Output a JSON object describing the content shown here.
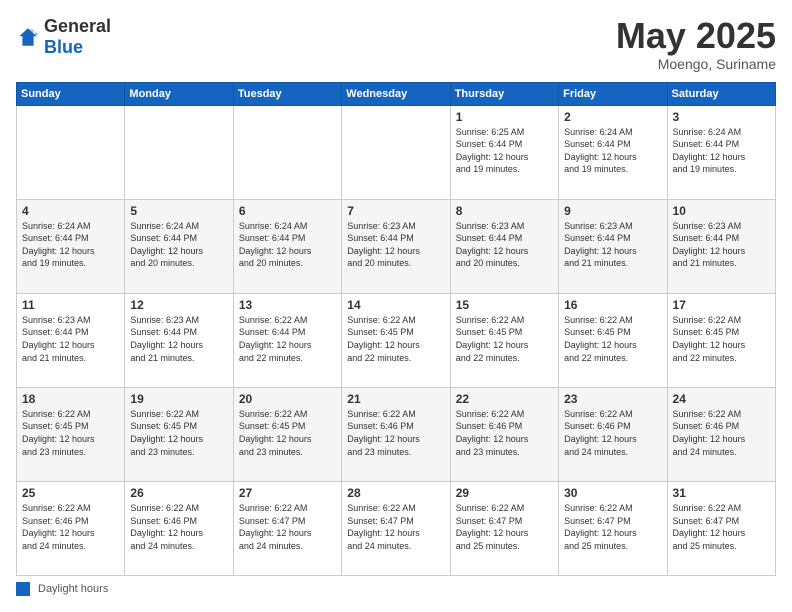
{
  "header": {
    "logo_general": "General",
    "logo_blue": "Blue",
    "month_title": "May 2025",
    "location": "Moengo, Suriname"
  },
  "footer": {
    "daylight_label": "Daylight hours"
  },
  "days_of_week": [
    "Sunday",
    "Monday",
    "Tuesday",
    "Wednesday",
    "Thursday",
    "Friday",
    "Saturday"
  ],
  "weeks": [
    [
      {
        "day": "",
        "info": ""
      },
      {
        "day": "",
        "info": ""
      },
      {
        "day": "",
        "info": ""
      },
      {
        "day": "",
        "info": ""
      },
      {
        "day": "1",
        "info": "Sunrise: 6:25 AM\nSunset: 6:44 PM\nDaylight: 12 hours\nand 19 minutes."
      },
      {
        "day": "2",
        "info": "Sunrise: 6:24 AM\nSunset: 6:44 PM\nDaylight: 12 hours\nand 19 minutes."
      },
      {
        "day": "3",
        "info": "Sunrise: 6:24 AM\nSunset: 6:44 PM\nDaylight: 12 hours\nand 19 minutes."
      }
    ],
    [
      {
        "day": "4",
        "info": "Sunrise: 6:24 AM\nSunset: 6:44 PM\nDaylight: 12 hours\nand 19 minutes."
      },
      {
        "day": "5",
        "info": "Sunrise: 6:24 AM\nSunset: 6:44 PM\nDaylight: 12 hours\nand 20 minutes."
      },
      {
        "day": "6",
        "info": "Sunrise: 6:24 AM\nSunset: 6:44 PM\nDaylight: 12 hours\nand 20 minutes."
      },
      {
        "day": "7",
        "info": "Sunrise: 6:23 AM\nSunset: 6:44 PM\nDaylight: 12 hours\nand 20 minutes."
      },
      {
        "day": "8",
        "info": "Sunrise: 6:23 AM\nSunset: 6:44 PM\nDaylight: 12 hours\nand 20 minutes."
      },
      {
        "day": "9",
        "info": "Sunrise: 6:23 AM\nSunset: 6:44 PM\nDaylight: 12 hours\nand 21 minutes."
      },
      {
        "day": "10",
        "info": "Sunrise: 6:23 AM\nSunset: 6:44 PM\nDaylight: 12 hours\nand 21 minutes."
      }
    ],
    [
      {
        "day": "11",
        "info": "Sunrise: 6:23 AM\nSunset: 6:44 PM\nDaylight: 12 hours\nand 21 minutes."
      },
      {
        "day": "12",
        "info": "Sunrise: 6:23 AM\nSunset: 6:44 PM\nDaylight: 12 hours\nand 21 minutes."
      },
      {
        "day": "13",
        "info": "Sunrise: 6:22 AM\nSunset: 6:44 PM\nDaylight: 12 hours\nand 22 minutes."
      },
      {
        "day": "14",
        "info": "Sunrise: 6:22 AM\nSunset: 6:45 PM\nDaylight: 12 hours\nand 22 minutes."
      },
      {
        "day": "15",
        "info": "Sunrise: 6:22 AM\nSunset: 6:45 PM\nDaylight: 12 hours\nand 22 minutes."
      },
      {
        "day": "16",
        "info": "Sunrise: 6:22 AM\nSunset: 6:45 PM\nDaylight: 12 hours\nand 22 minutes."
      },
      {
        "day": "17",
        "info": "Sunrise: 6:22 AM\nSunset: 6:45 PM\nDaylight: 12 hours\nand 22 minutes."
      }
    ],
    [
      {
        "day": "18",
        "info": "Sunrise: 6:22 AM\nSunset: 6:45 PM\nDaylight: 12 hours\nand 23 minutes."
      },
      {
        "day": "19",
        "info": "Sunrise: 6:22 AM\nSunset: 6:45 PM\nDaylight: 12 hours\nand 23 minutes."
      },
      {
        "day": "20",
        "info": "Sunrise: 6:22 AM\nSunset: 6:45 PM\nDaylight: 12 hours\nand 23 minutes."
      },
      {
        "day": "21",
        "info": "Sunrise: 6:22 AM\nSunset: 6:46 PM\nDaylight: 12 hours\nand 23 minutes."
      },
      {
        "day": "22",
        "info": "Sunrise: 6:22 AM\nSunset: 6:46 PM\nDaylight: 12 hours\nand 23 minutes."
      },
      {
        "day": "23",
        "info": "Sunrise: 6:22 AM\nSunset: 6:46 PM\nDaylight: 12 hours\nand 24 minutes."
      },
      {
        "day": "24",
        "info": "Sunrise: 6:22 AM\nSunset: 6:46 PM\nDaylight: 12 hours\nand 24 minutes."
      }
    ],
    [
      {
        "day": "25",
        "info": "Sunrise: 6:22 AM\nSunset: 6:46 PM\nDaylight: 12 hours\nand 24 minutes."
      },
      {
        "day": "26",
        "info": "Sunrise: 6:22 AM\nSunset: 6:46 PM\nDaylight: 12 hours\nand 24 minutes."
      },
      {
        "day": "27",
        "info": "Sunrise: 6:22 AM\nSunset: 6:47 PM\nDaylight: 12 hours\nand 24 minutes."
      },
      {
        "day": "28",
        "info": "Sunrise: 6:22 AM\nSunset: 6:47 PM\nDaylight: 12 hours\nand 24 minutes."
      },
      {
        "day": "29",
        "info": "Sunrise: 6:22 AM\nSunset: 6:47 PM\nDaylight: 12 hours\nand 25 minutes."
      },
      {
        "day": "30",
        "info": "Sunrise: 6:22 AM\nSunset: 6:47 PM\nDaylight: 12 hours\nand 25 minutes."
      },
      {
        "day": "31",
        "info": "Sunrise: 6:22 AM\nSunset: 6:47 PM\nDaylight: 12 hours\nand 25 minutes."
      }
    ]
  ]
}
